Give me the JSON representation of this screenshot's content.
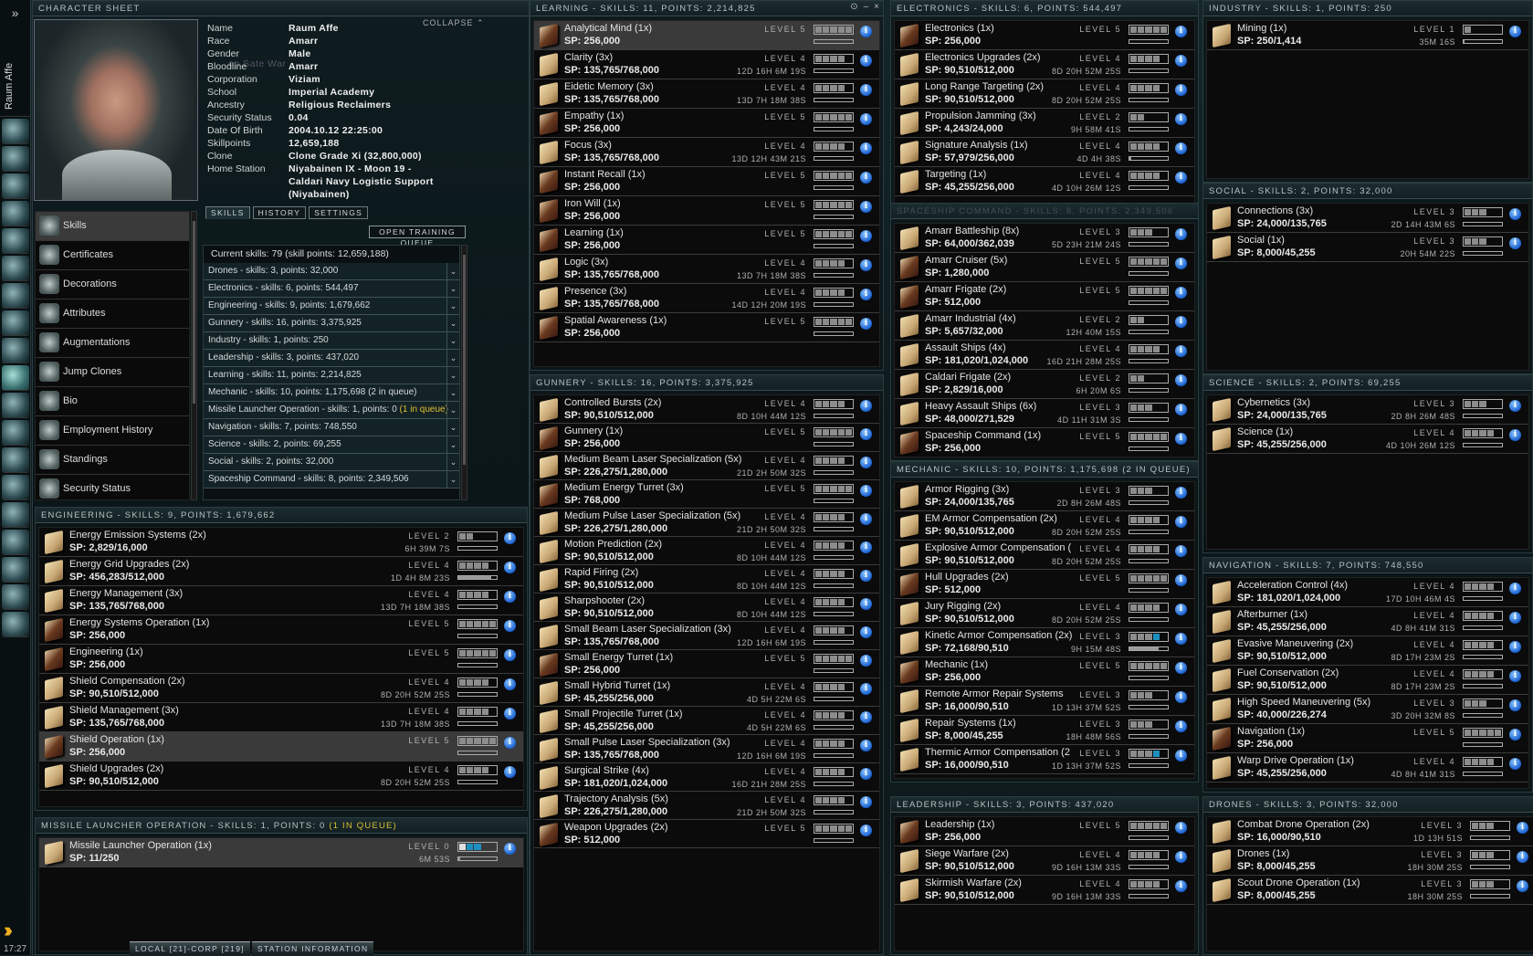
{
  "toolbar": {
    "user": "Raum Affe",
    "clock": "17:27",
    "expand": "»"
  },
  "character": {
    "title": "CHARACTER SHEET",
    "collapse": "COLLAPSE ⌃",
    "ghost_text": "on Sate War",
    "fields": [
      {
        "label": "Name",
        "value": "Raum Affe"
      },
      {
        "label": "Race",
        "value": "Amarr"
      },
      {
        "label": "Gender",
        "value": "Male"
      },
      {
        "label": "Bloodline",
        "value": "Amarr"
      },
      {
        "label": "Corporation",
        "value": "Viziam"
      },
      {
        "label": "School",
        "value": "Imperial Academy"
      },
      {
        "label": "Ancestry",
        "value": "Religious Reclaimers"
      },
      {
        "label": "Security Status",
        "value": "0.04"
      },
      {
        "label": "Date Of Birth",
        "value": "2004.10.12 22:25:00"
      },
      {
        "label": "Skillpoints",
        "value": "12,659,188"
      },
      {
        "label": "Clone",
        "value": "Clone Grade Xi (32,800,000)"
      },
      {
        "label": "Home Station",
        "value": "Niyabainen IX - Moon 19 -"
      },
      {
        "label": "",
        "value": "Caldari Navy Logistic Support"
      },
      {
        "label": "",
        "value": "(Niyabainen)"
      }
    ],
    "nav": [
      "Skills",
      "Certificates",
      "Decorations",
      "Attributes",
      "Augmentations",
      "Jump Clones",
      "Bio",
      "Employment History",
      "Standings",
      "Security Status"
    ],
    "tabs": [
      "SKILLS",
      "HISTORY",
      "SETTINGS"
    ],
    "open_training_queue": "OPEN TRAINING QUEUE",
    "current_skills": "Current skills: 79 (skill points: 12,659,188)",
    "summary": [
      {
        "text": "Drones - skills: 3, points: 32,000"
      },
      {
        "text": "Electronics - skills: 6, points: 544,497"
      },
      {
        "text": "Engineering - skills: 9, points: 1,679,662"
      },
      {
        "text": "Gunnery - skills: 16, points: 3,375,925"
      },
      {
        "text": "Industry - skills: 1, points: 250"
      },
      {
        "text": "Leadership - skills: 3, points: 437,020"
      },
      {
        "text": "Learning - skills: 11, points: 2,214,825"
      },
      {
        "text": "Mechanic - skills: 10, points: 1,175,698 (2 in queue)"
      },
      {
        "text": "Missile Launcher Operation - skills: 1, points: 0 ",
        "queue": "(1 in queue)"
      },
      {
        "text": "Navigation - skills: 7, points: 748,550"
      },
      {
        "text": "Science - skills: 2, points: 69,255"
      },
      {
        "text": "Social - skills: 2, points: 32,000"
      },
      {
        "text": "Spaceship Command - skills: 8, points: 2,349,506"
      }
    ]
  },
  "bottom_tabs": [
    "LOCAL [21]-CORP [219]",
    "STATION INFORMATION"
  ],
  "window_buttons": [
    "⊙",
    "–",
    "×"
  ],
  "level_prefix": "LEVEL",
  "panels": {
    "learning": {
      "title": "LEARNING - SKILLS: 11, POINTS: 2,214,825",
      "skills": [
        {
          "n": "Analytical Mind (1x)",
          "sp": "SP: 256,000",
          "lv": 5,
          "t": "",
          "sel": true
        },
        {
          "n": "Clarity (3x)",
          "sp": "SP: 135,765/768,000",
          "lv": 4,
          "t": "12D 16H 6M 19S"
        },
        {
          "n": "Eidetic Memory (3x)",
          "sp": "SP: 135,765/768,000",
          "lv": 4,
          "t": "13D 7H 18M 38S"
        },
        {
          "n": "Empathy (1x)",
          "sp": "SP: 256,000",
          "lv": 5,
          "t": ""
        },
        {
          "n": "Focus (3x)",
          "sp": "SP: 135,765/768,000",
          "lv": 4,
          "t": "13D 12H 43M 21S"
        },
        {
          "n": "Instant Recall (1x)",
          "sp": "SP: 256,000",
          "lv": 5,
          "t": ""
        },
        {
          "n": "Iron Will (1x)",
          "sp": "SP: 256,000",
          "lv": 5,
          "t": ""
        },
        {
          "n": "Learning (1x)",
          "sp": "SP: 256,000",
          "lv": 5,
          "t": ""
        },
        {
          "n": "Logic (3x)",
          "sp": "SP: 135,765/768,000",
          "lv": 4,
          "t": "13D 7H 18M 38S"
        },
        {
          "n": "Presence (3x)",
          "sp": "SP: 135,765/768,000",
          "lv": 4,
          "t": "14D 12H 20M 19S"
        },
        {
          "n": "Spatial Awareness (1x)",
          "sp": "SP: 256,000",
          "lv": 5,
          "t": ""
        }
      ]
    },
    "gunnery": {
      "title": "GUNNERY - SKILLS: 16, POINTS: 3,375,925",
      "skills": [
        {
          "n": "Controlled Bursts (2x)",
          "sp": "SP: 90,510/512,000",
          "lv": 4,
          "t": "8D 10H 44M 12S"
        },
        {
          "n": "Gunnery (1x)",
          "sp": "SP: 256,000",
          "lv": 5,
          "t": ""
        },
        {
          "n": "Medium Beam Laser Specialization (5x)",
          "sp": "SP: 226,275/1,280,000",
          "lv": 4,
          "t": "21D 2H 50M 32S"
        },
        {
          "n": "Medium Energy Turret (3x)",
          "sp": "SP: 768,000",
          "lv": 5,
          "t": ""
        },
        {
          "n": "Medium Pulse Laser Specialization (5x)",
          "sp": "SP: 226,275/1,280,000",
          "lv": 4,
          "t": "21D 2H 50M 32S"
        },
        {
          "n": "Motion Prediction (2x)",
          "sp": "SP: 90,510/512,000",
          "lv": 4,
          "t": "8D 10H 44M 12S"
        },
        {
          "n": "Rapid Firing (2x)",
          "sp": "SP: 90,510/512,000",
          "lv": 4,
          "t": "8D 10H 44M 12S"
        },
        {
          "n": "Sharpshooter (2x)",
          "sp": "SP: 90,510/512,000",
          "lv": 4,
          "t": "8D 10H 44M 12S"
        },
        {
          "n": "Small Beam Laser Specialization (3x)",
          "sp": "SP: 135,765/768,000",
          "lv": 4,
          "t": "12D 16H 6M 19S"
        },
        {
          "n": "Small Energy Turret (1x)",
          "sp": "SP: 256,000",
          "lv": 5,
          "t": ""
        },
        {
          "n": "Small Hybrid Turret (1x)",
          "sp": "SP: 45,255/256,000",
          "lv": 4,
          "t": "4D 5H 22M 6S"
        },
        {
          "n": "Small Projectile Turret (1x)",
          "sp": "SP: 45,255/256,000",
          "lv": 4,
          "t": "4D 5H 22M 6S"
        },
        {
          "n": "Small Pulse Laser Specialization (3x)",
          "sp": "SP: 135,765/768,000",
          "lv": 4,
          "t": "12D 16H 6M 19S"
        },
        {
          "n": "Surgical Strike (4x)",
          "sp": "SP: 181,020/1,024,000",
          "lv": 4,
          "t": "16D 21H 28M 25S"
        },
        {
          "n": "Trajectory Analysis (5x)",
          "sp": "SP: 226,275/1,280,000",
          "lv": 4,
          "t": "21D 2H 50M 32S"
        },
        {
          "n": "Weapon Upgrades (2x)",
          "sp": "SP: 512,000",
          "lv": 5,
          "t": ""
        }
      ]
    },
    "electronics": {
      "title": "ELECTRONICS - SKILLS: 6, POINTS: 544,497",
      "skills": [
        {
          "n": "Electronics (1x)",
          "sp": "SP: 256,000",
          "lv": 5,
          "t": ""
        },
        {
          "n": "Electronics Upgrades (2x)",
          "sp": "SP: 90,510/512,000",
          "lv": 4,
          "t": "8D 20H 52M 25S"
        },
        {
          "n": "Long Range Targeting (2x)",
          "sp": "SP: 90,510/512,000",
          "lv": 4,
          "t": "8D 20H 52M 25S"
        },
        {
          "n": "Propulsion Jamming (3x)",
          "sp": "SP: 4,243/24,000",
          "lv": 2,
          "t": "9H 58M 41S"
        },
        {
          "n": "Signature Analysis (1x)",
          "sp": "SP: 57,979/256,000",
          "lv": 4,
          "t": "4D 4H 38S",
          "p": 0.05
        },
        {
          "n": "Targeting (1x)",
          "sp": "SP: 45,255/256,000",
          "lv": 4,
          "t": "4D 10H 26M 12S"
        }
      ]
    },
    "spaceship": {
      "title": "SPACESHIP COMMAND - SKILLS: 8, POINTS: 2,349,506",
      "skills": [
        {
          "n": "Amarr Battleship (8x)",
          "sp": "SP: 64,000/362,039",
          "lv": 3,
          "t": "5D 23H 21M 24S"
        },
        {
          "n": "Amarr Cruiser (5x)",
          "sp": "SP: 1,280,000",
          "lv": 5,
          "t": ""
        },
        {
          "n": "Amarr Frigate (2x)",
          "sp": "SP: 512,000",
          "lv": 5,
          "t": ""
        },
        {
          "n": "Amarr Industrial (4x)",
          "sp": "SP: 5,657/32,000",
          "lv": 2,
          "t": "12H 40M 15S"
        },
        {
          "n": "Assault Ships (4x)",
          "sp": "SP: 181,020/1,024,000",
          "lv": 4,
          "t": "16D 21H 28M 25S"
        },
        {
          "n": "Caldari Frigate (2x)",
          "sp": "SP: 2,829/16,000",
          "lv": 2,
          "t": "6H 20M 6S"
        },
        {
          "n": "Heavy Assault Ships (6x)",
          "sp": "SP: 48,000/271,529",
          "lv": 3,
          "t": "4D 11H 31M 3S"
        },
        {
          "n": "Spaceship Command (1x)",
          "sp": "SP: 256,000",
          "lv": 5,
          "t": ""
        }
      ]
    },
    "mechanic": {
      "title": "MECHANIC - SKILLS: 10, POINTS: 1,175,698 (2 IN QUEUE)",
      "skills": [
        {
          "n": "Armor Rigging (3x)",
          "sp": "SP: 24,000/135,765",
          "lv": 3,
          "t": "2D 8H 26M 48S"
        },
        {
          "n": "EM Armor Compensation (2x)",
          "sp": "SP: 90,510/512,000",
          "lv": 4,
          "t": "8D 20H 52M 25S"
        },
        {
          "n": "Explosive Armor Compensation (",
          "sp": "SP: 90,510/512,000",
          "lv": 4,
          "t": "8D 20H 52M 25S"
        },
        {
          "n": "Hull Upgrades (2x)",
          "sp": "SP: 512,000",
          "lv": 5,
          "t": ""
        },
        {
          "n": "Jury Rigging (2x)",
          "sp": "SP: 90,510/512,000",
          "lv": 4,
          "t": "8D 20H 52M 25S"
        },
        {
          "n": "Kinetic Armor Compensation (2x)",
          "sp": "SP: 72,168/90,510",
          "lv": 3,
          "t": "9H 15M 48S",
          "p": 0.75,
          "q": 1
        },
        {
          "n": "Mechanic (1x)",
          "sp": "SP: 256,000",
          "lv": 5,
          "t": ""
        },
        {
          "n": "Remote Armor Repair Systems",
          "sp": "SP: 16,000/90,510",
          "lv": 3,
          "t": "1D 13H 37M 52S"
        },
        {
          "n": "Repair Systems (1x)",
          "sp": "SP: 8,000/45,255",
          "lv": 3,
          "t": "18H 48M 56S"
        },
        {
          "n": "Thermic Armor Compensation (2",
          "sp": "SP: 16,000/90,510",
          "lv": 3,
          "t": "1D 13H 37M 52S",
          "q": 1
        }
      ]
    },
    "leadership": {
      "title": "LEADERSHIP - SKILLS: 3, POINTS: 437,020",
      "skills": [
        {
          "n": "Leadership (1x)",
          "sp": "SP: 256,000",
          "lv": 5,
          "t": ""
        },
        {
          "n": "Siege Warfare (2x)",
          "sp": "SP: 90,510/512,000",
          "lv": 4,
          "t": "9D 16H 13M 33S"
        },
        {
          "n": "Skirmish Warfare (2x)",
          "sp": "SP: 90,510/512,000",
          "lv": 4,
          "t": "9D 16H 13M 33S"
        }
      ]
    },
    "industry": {
      "title": "INDUSTRY - SKILLS: 1, POINTS: 250",
      "skills": [
        {
          "n": "Mining (1x)",
          "sp": "SP: 250/1,414",
          "lv": 1,
          "t": "35M 16S",
          "p": 0.02
        }
      ]
    },
    "social": {
      "title": "SOCIAL - SKILLS: 2, POINTS: 32,000",
      "skills": [
        {
          "n": "Connections (3x)",
          "sp": "SP: 24,000/135,765",
          "lv": 3,
          "t": "2D 14H 43M 6S"
        },
        {
          "n": "Social (1x)",
          "sp": "SP: 8,000/45,255",
          "lv": 3,
          "t": "20H 54M 22S"
        }
      ]
    },
    "science": {
      "title": "SCIENCE - SKILLS: 2, POINTS: 69,255",
      "skills": [
        {
          "n": "Cybernetics (3x)",
          "sp": "SP: 24,000/135,765",
          "lv": 3,
          "t": "2D 8H 26M 48S"
        },
        {
          "n": "Science (1x)",
          "sp": "SP: 45,255/256,000",
          "lv": 4,
          "t": "4D 10H 26M 12S"
        }
      ]
    },
    "navigation": {
      "title": "NAVIGATION - SKILLS: 7, POINTS: 748,550",
      "skills": [
        {
          "n": "Acceleration Control (4x)",
          "sp": "SP: 181,020/1,024,000",
          "lv": 4,
          "t": "17D 10H 46M 4S"
        },
        {
          "n": "Afterburner (1x)",
          "sp": "SP: 45,255/256,000",
          "lv": 4,
          "t": "4D 8H 41M 31S"
        },
        {
          "n": "Evasive Maneuvering (2x)",
          "sp": "SP: 90,510/512,000",
          "lv": 4,
          "t": "8D 17H 23M 2S"
        },
        {
          "n": "Fuel Conservation (2x)",
          "sp": "SP: 90,510/512,000",
          "lv": 4,
          "t": "8D 17H 23M 2S"
        },
        {
          "n": "High Speed Maneuvering (5x)",
          "sp": "SP: 40,000/226,274",
          "lv": 3,
          "t": "3D 20H 32M 8S"
        },
        {
          "n": "Navigation (1x)",
          "sp": "SP: 256,000",
          "lv": 5,
          "t": ""
        },
        {
          "n": "Warp Drive Operation (1x)",
          "sp": "SP: 45,255/256,000",
          "lv": 4,
          "t": "4D 8H 41M 31S"
        }
      ]
    },
    "drones": {
      "title": "DRONES - SKILLS: 3, POINTS: 32,000",
      "skills": [
        {
          "n": "Combat Drone Operation (2x)",
          "sp": "SP: 16,000/90,510",
          "lv": 3,
          "t": "1D 13H 51S"
        },
        {
          "n": "Drones (1x)",
          "sp": "SP: 8,000/45,255",
          "lv": 3,
          "t": "18H 30M 25S"
        },
        {
          "n": "Scout Drone Operation (1x)",
          "sp": "SP: 8,000/45,255",
          "lv": 3,
          "t": "18H 30M 25S"
        }
      ]
    },
    "engineering": {
      "title": "ENGINEERING - SKILLS: 9, POINTS: 1,679,662",
      "skills": [
        {
          "n": "Energy Emission Systems (2x)",
          "sp": "SP: 2,829/16,000",
          "lv": 2,
          "t": "6H 39M 7S"
        },
        {
          "n": "Energy Grid Upgrades (2x)",
          "sp": "SP: 456,283/512,000",
          "lv": 4,
          "t": "1D 4H 8M 23S",
          "p": 0.85
        },
        {
          "n": "Energy Management (3x)",
          "sp": "SP: 135,765/768,000",
          "lv": 4,
          "t": "13D 7H 18M 38S"
        },
        {
          "n": "Energy Systems Operation (1x)",
          "sp": "SP: 256,000",
          "lv": 5,
          "t": ""
        },
        {
          "n": "Engineering (1x)",
          "sp": "SP: 256,000",
          "lv": 5,
          "t": ""
        },
        {
          "n": "Shield Compensation (2x)",
          "sp": "SP: 90,510/512,000",
          "lv": 4,
          "t": "8D 20H 52M 25S"
        },
        {
          "n": "Shield Management (3x)",
          "sp": "SP: 135,765/768,000",
          "lv": 4,
          "t": "13D 7H 18M 38S"
        },
        {
          "n": "Shield Operation (1x)",
          "sp": "SP: 256,000",
          "lv": 5,
          "t": "",
          "sel": true
        },
        {
          "n": "Shield Upgrades (2x)",
          "sp": "SP: 90,510/512,000",
          "lv": 4,
          "t": "8D 20H 52M 25S"
        }
      ]
    },
    "missile": {
      "title": "MISSILE LAUNCHER OPERATION - SKILLS: 1, POINTS: 0 ",
      "title_queue": "(1 IN QUEUE)",
      "skills": [
        {
          "n": "Missile Launcher Operation (1x)",
          "sp": "SP: 11/250",
          "lv": 0,
          "t": "6M 53S",
          "p": 0.04,
          "q": 2,
          "training": true,
          "sel": true
        }
      ]
    }
  }
}
